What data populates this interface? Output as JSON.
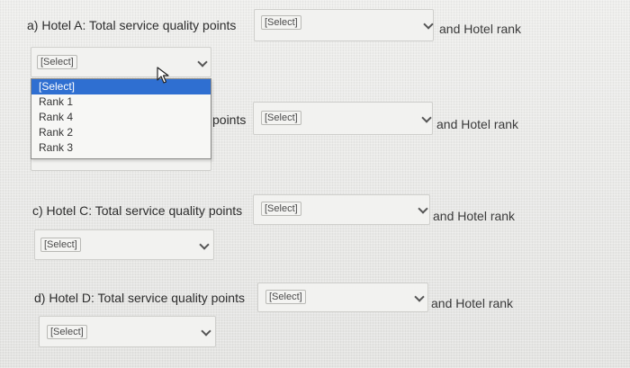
{
  "questions": {
    "a": {
      "label": "a) Hotel A: Total service quality points",
      "select_value": "[Select]",
      "suffix": "and Hotel rank",
      "rank_value": "[Select]"
    },
    "b": {
      "label_fragment": "points",
      "select_value": "[Select]",
      "suffix": "and Hotel rank"
    },
    "c": {
      "label": "c) Hotel C: Total service quality points",
      "select_value": "[Select]",
      "suffix": "and Hotel rank",
      "rank_value": "[Select]"
    },
    "d": {
      "label": "d) Hotel D: Total service quality points",
      "select_value": "[Select]",
      "suffix": "and Hotel rank",
      "rank_value": "[Select]"
    }
  },
  "rank_dropdown": {
    "options": [
      "[Select]",
      "Rank 1",
      "Rank 4",
      "Rank 2",
      "Rank 3"
    ],
    "highlighted": "[Select]"
  },
  "icons": {
    "chevron": "chevron-down-icon",
    "cursor": "mouse-pointer-icon"
  },
  "colors": {
    "highlight": "#2f6fd1",
    "background": "#e9e9e7"
  }
}
